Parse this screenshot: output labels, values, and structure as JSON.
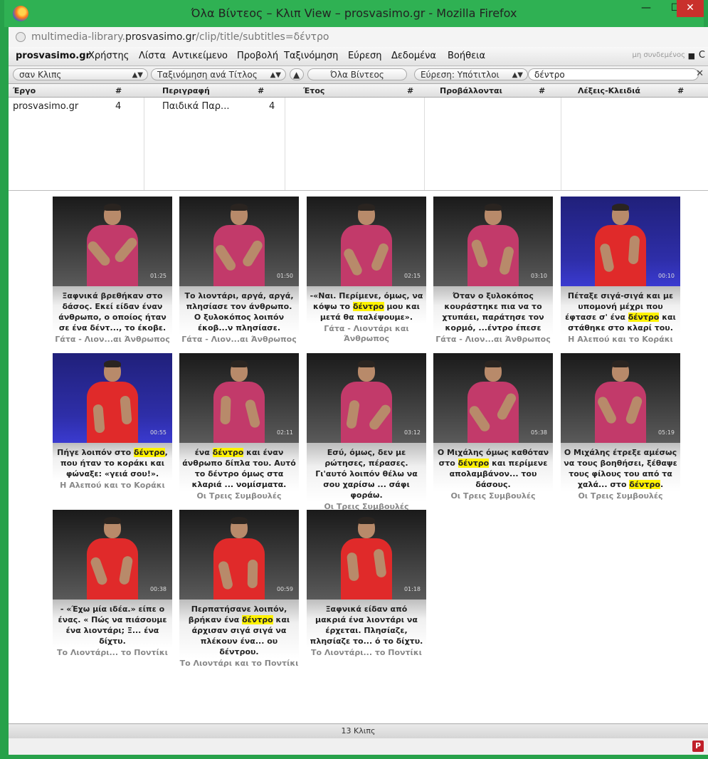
{
  "window": {
    "title": "Όλα Βίντεος – Κλιπ View – prosvasimo.gr - Mozilla Firefox",
    "min": "—",
    "max": "☐",
    "close": "✕"
  },
  "url": {
    "prefix": "multimedia-library.",
    "domain": "prosvasimo.gr",
    "path": "/clip/title/subtitles=δέντρο"
  },
  "menu": {
    "brand": "prosvasimo.gr",
    "items": [
      "Χρήστης",
      "Λίστα",
      "Αντικείμενο",
      "Προβολή",
      "Ταξινόμηση",
      "Εύρεση",
      "Δεδομένα",
      "Βοήθεια"
    ],
    "login": "μη συνδεμένος",
    "reload": "C"
  },
  "filter": {
    "view": "σαν Κλιπς",
    "sort": "Ταξινόμηση ανά Τίτλος",
    "scope": "Όλα Βίντεος",
    "find": "Εύρεση: Υπότιτλοι",
    "query": "δέντρο",
    "clear": "✕"
  },
  "columns": {
    "headers": [
      "Έργο",
      "Περιγραφή",
      "Έτος",
      "Προβάλλονται",
      "Λέξεις-Κλειδιά"
    ],
    "count_label": "#"
  },
  "browser": {
    "col1": {
      "name": "prosvasimo.gr",
      "count": "4"
    },
    "col2": {
      "name": "Παιδικά Παρ...",
      "count": "4"
    }
  },
  "clips": [
    {
      "caption_pre": "Ξαφνικά βρεθήκαν στο δάσος. Εκεί είδαν έναν άνθρωπο, ο οποίος ήταν σε ένα δέντ..., το έκοβε.",
      "hl": "",
      "caption_post": "",
      "source": "Γάτα - Λιον...αι Άνθρωπος",
      "time": "01:25",
      "bg": "dark",
      "shirt": "#c23a6a"
    },
    {
      "caption_pre": "Το λιοντάρι, αργά, αργά, πλησίασε τον άνθρωπο. Ο ξυλοκόπος λοιπόν έκοβ...ν πλησίασε.",
      "hl": "",
      "caption_post": "",
      "source": "Γάτα - Λιον...αι Άνθρωπος",
      "time": "01:50",
      "bg": "dark",
      "shirt": "#c23a6a"
    },
    {
      "caption_pre": "-«Ναι. Περίμενε, όμως, να κόψω το ",
      "hl": "δέντρο",
      "caption_post": " μου και μετά θα παλέψουμε».",
      "source": "Γάτα - Λιοντάρι και Άνθρωπος",
      "time": "02:15",
      "bg": "dark",
      "shirt": "#c23a6a"
    },
    {
      "caption_pre": "Όταν ο ξυλοκόπος κουράστηκε πια να το χτυπάει, παράτησε τον κορμό, ...έντρο έπεσε",
      "hl": "",
      "caption_post": "",
      "source": "Γάτα - Λιον...αι Άνθρωπος",
      "time": "03:10",
      "bg": "dark",
      "shirt": "#c23a6a"
    },
    {
      "caption_pre": "Πέταξε σιγά-σιγά και με υπομονή μέχρι που έφτασε σ' ένα ",
      "hl": "δέντρο",
      "caption_post": " και στάθηκε στο κλαρί του.",
      "source": "Η Αλεπού και το Κοράκι",
      "time": "00:10",
      "bg": "blue",
      "shirt": "#e02a2a"
    },
    {
      "caption_pre": "Πήγε λοιπόν στο ",
      "hl": "δέντρο",
      "caption_post": ", που ήταν το κοράκι και φώναξε: «γειά σου!».",
      "source": "Η Αλεπού και το Κοράκι",
      "time": "00:55",
      "bg": "blue",
      "shirt": "#e02a2a"
    },
    {
      "caption_pre": "ένα ",
      "hl": "δέντρο",
      "caption_post": " και έναν άνθρωπο δίπλα του. Αυτό το δέντρο όμως στα κλαριά ... νομίσματα.",
      "source": "Οι Τρεις Συμβουλές",
      "time": "02:11",
      "bg": "dark",
      "shirt": "#c23a6a"
    },
    {
      "caption_pre": "Εσύ, όμως, δεν με ρώτησες, πέρασες. Γι'αυτό λοιπόν θέλω να σου χαρίσω ... σάφι φοράω.",
      "hl": "",
      "caption_post": "",
      "source": "Οι Τρεις Συμβουλές",
      "time": "03:12",
      "bg": "dark",
      "shirt": "#c23a6a"
    },
    {
      "caption_pre": "Ο Μιχάλης όμως καθόταν στο ",
      "hl": "δέντρο",
      "caption_post": " και περίμενε απολαμβάνον... του δάσους.",
      "source": "Οι Τρεις Συμβουλές",
      "time": "05:38",
      "bg": "dark",
      "shirt": "#c23a6a"
    },
    {
      "caption_pre": "Ο Μιχάλης έτρεξε αμέσως να τους βοηθήσει, ξέθαψε τους φίλους του από τα χαλά... στο ",
      "hl": "δέντρο",
      "caption_post": ".",
      "source": "Οι Τρεις Συμβουλές",
      "time": "05:19",
      "bg": "dark",
      "shirt": "#c23a6a"
    },
    {
      "caption_pre": "- «Έχω μία ιδέα.» είπε ο ένας. « Πώς να πιάσουμε ένα λιοντάρι; Ξ... ένα δίχτυ.",
      "hl": "",
      "caption_post": "",
      "source": "Το Λιοντάρι... το Ποντίκι",
      "time": "00:38",
      "bg": "dark",
      "shirt": "#e02a2a"
    },
    {
      "caption_pre": "Περπατήσανε λοιπόν, βρήκαν ένα ",
      "hl": "δέντρο",
      "caption_post": " και άρχισαν σιγά σιγά να πλέκουν ένα... ου δέντρου.",
      "source": "Το Λιοντάρι και το Ποντίκι",
      "time": "00:59",
      "bg": "dark",
      "shirt": "#e02a2a"
    },
    {
      "caption_pre": "Ξαφνικά είδαν από μακριά ένα λιοντάρι να έρχεται. Πλησίαζε, πλησίαζε το... ό το δίχτυ.",
      "hl": "",
      "caption_post": "",
      "source": "Το Λιοντάρι... το Ποντίκι",
      "time": "01:18",
      "bg": "dark",
      "shirt": "#e02a2a"
    }
  ],
  "status": "13 Κλιπς",
  "addon_button": "P"
}
